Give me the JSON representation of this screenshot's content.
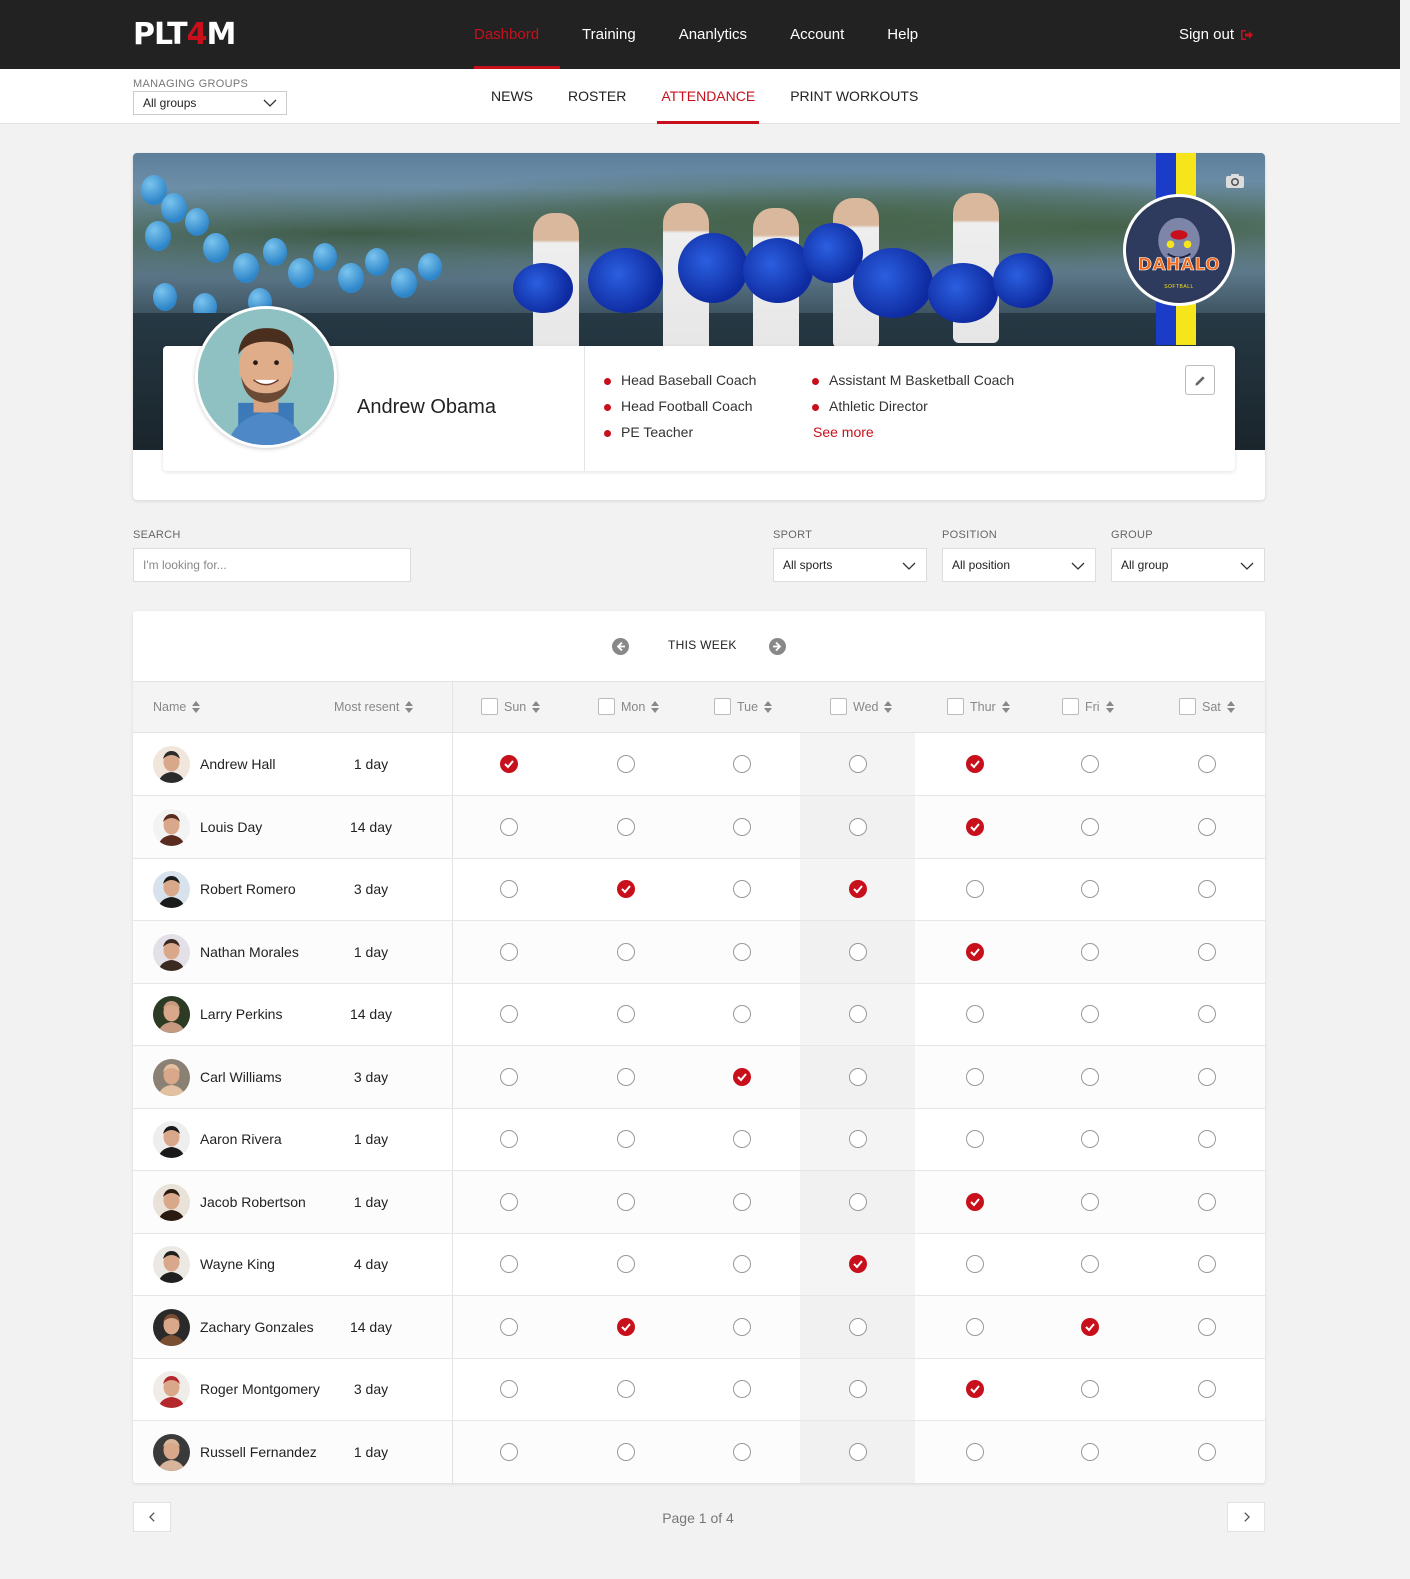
{
  "brand": {
    "logo_part1": "PLT",
    "logo_part2": "4",
    "logo_part3": "M"
  },
  "topnav": {
    "items": [
      {
        "label": "Dashbord",
        "active": true
      },
      {
        "label": "Training",
        "active": false
      },
      {
        "label": "Ananlytics",
        "active": false
      },
      {
        "label": "Account",
        "active": false
      },
      {
        "label": "Help",
        "active": false
      }
    ],
    "signout": "Sign out"
  },
  "subbar": {
    "managing_label": "MANAGING GROUPS",
    "managing_value": "All groups",
    "tabs": [
      {
        "label": "NEWS",
        "active": false
      },
      {
        "label": "ROSTER",
        "active": false
      },
      {
        "label": "ATTENDANCE",
        "active": true
      },
      {
        "label": "PRINT WORKOUTS",
        "active": false
      }
    ]
  },
  "profile": {
    "name": "Andrew Obama",
    "roles": [
      "Head Baseball Coach",
      "Head Football Coach",
      "PE Teacher",
      "Assistant M Basketball Coach",
      "Athletic Director"
    ],
    "see_more": "See more",
    "team_logo_text": "DAHALO",
    "team_logo_sub": "SOFTBALL"
  },
  "filters": {
    "search_label": "SEARCH",
    "search_placeholder": "I'm looking for...",
    "sport_label": "SPORT",
    "sport_value": "All sports",
    "position_label": "POSITION",
    "position_value": "All position",
    "group_label": "GROUP",
    "group_value": "All group"
  },
  "attendance": {
    "week_label": "THIS WEEK",
    "col_name": "Name",
    "col_recent": "Most resent",
    "days": [
      "Sun",
      "Mon",
      "Tue",
      "Wed",
      "Thur",
      "Fri",
      "Sat"
    ],
    "rows": [
      {
        "name": "Andrew Hall",
        "recent": "1 day",
        "att": [
          1,
          0,
          0,
          0,
          1,
          0,
          0
        ]
      },
      {
        "name": "Louis Day",
        "recent": "14 day",
        "att": [
          0,
          0,
          0,
          0,
          1,
          0,
          0
        ]
      },
      {
        "name": "Robert Romero",
        "recent": "3 day",
        "att": [
          0,
          1,
          0,
          1,
          0,
          0,
          0
        ]
      },
      {
        "name": "Nathan Morales",
        "recent": "1 day",
        "att": [
          0,
          0,
          0,
          0,
          1,
          0,
          0
        ]
      },
      {
        "name": "Larry Perkins",
        "recent": "14 day",
        "att": [
          0,
          0,
          0,
          0,
          0,
          0,
          0
        ]
      },
      {
        "name": "Carl Williams",
        "recent": "3 day",
        "att": [
          0,
          0,
          1,
          0,
          0,
          0,
          0
        ]
      },
      {
        "name": "Aaron Rivera",
        "recent": "1 day",
        "att": [
          0,
          0,
          0,
          0,
          0,
          0,
          0
        ]
      },
      {
        "name": "Jacob Robertson",
        "recent": "1 day",
        "att": [
          0,
          0,
          0,
          0,
          1,
          0,
          0
        ]
      },
      {
        "name": "Wayne King",
        "recent": "4 day",
        "att": [
          0,
          0,
          0,
          1,
          0,
          0,
          0
        ]
      },
      {
        "name": "Zachary Gonzales",
        "recent": "14 day",
        "att": [
          0,
          1,
          0,
          0,
          0,
          1,
          0
        ]
      },
      {
        "name": "Roger Montgomery",
        "recent": "3 day",
        "att": [
          0,
          0,
          0,
          0,
          1,
          0,
          0
        ]
      },
      {
        "name": "Russell Fernandez",
        "recent": "1 day",
        "att": [
          0,
          0,
          0,
          0,
          0,
          0,
          0
        ]
      }
    ]
  },
  "pagination": {
    "text": "Page 1 of 4"
  },
  "colors": {
    "accent": "#c8101c",
    "topbar": "#222222"
  }
}
